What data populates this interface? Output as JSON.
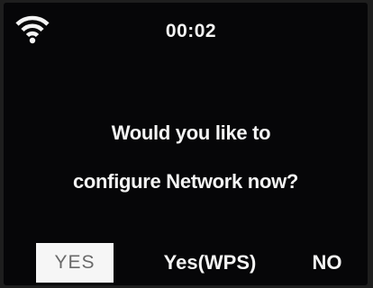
{
  "status_bar": {
    "wifi_icon": "wifi-icon",
    "time": "00:02"
  },
  "dialog": {
    "line1": "Would you like to",
    "line2": "configure Network now?"
  },
  "options": {
    "selected": "YES",
    "yes_label": "YES",
    "wps_label": "Yes(WPS)",
    "no_label": "NO"
  },
  "colors": {
    "screen_bg": "#060608",
    "text": "#f4f4f4",
    "selection_bg": "#f6f6f6",
    "selection_text": "#6a6a6a"
  }
}
